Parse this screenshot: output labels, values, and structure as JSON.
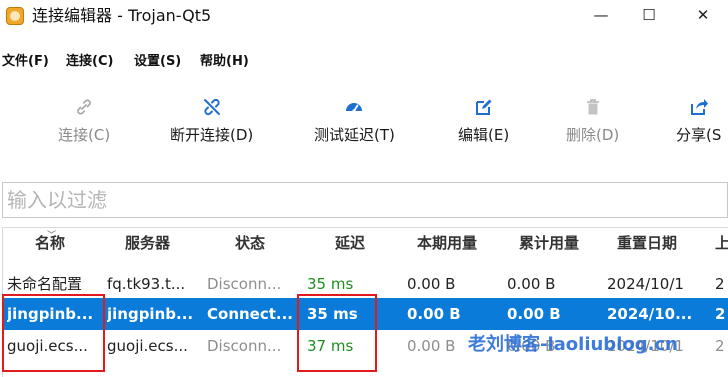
{
  "window": {
    "title": "连接编辑器 - Trojan-Qt5",
    "minimize": "—",
    "maximize": "☐",
    "close": "✕"
  },
  "menu": [
    "文件(F)",
    "连接(C)",
    "设置(S)",
    "帮助(H)"
  ],
  "toolbar": [
    {
      "label": "连接(C)",
      "icon": "link-icon",
      "enabled": false
    },
    {
      "label": "断开连接(D)",
      "icon": "unlink-icon",
      "enabled": true
    },
    {
      "label": "测试延迟(T)",
      "icon": "speedometer-icon",
      "enabled": true
    },
    {
      "label": "编辑(E)",
      "icon": "edit-icon",
      "enabled": true
    },
    {
      "label": "删除(D)",
      "icon": "trash-icon",
      "enabled": false
    },
    {
      "label": "分享(S",
      "icon": "share-icon",
      "enabled": true
    }
  ],
  "filter": {
    "placeholder": "输入以过滤",
    "value": ""
  },
  "columns": [
    "名称",
    "服务器",
    "状态",
    "延迟",
    "本期用量",
    "累计用量",
    "重置日期",
    "上"
  ],
  "rows": [
    {
      "name": "未命名配置",
      "server": "fq.tk93.t...",
      "status": "Disconn...",
      "latency": "35 ms",
      "period": "0.00  B",
      "total": "0.00  B",
      "reset": "2024/10/1",
      "extra": "2",
      "selected": false
    },
    {
      "name": "jingpinb...",
      "server": "jingpinb...",
      "status": "Connect...",
      "latency": "35 ms",
      "period": "0.00  B",
      "total": "0.00  B",
      "reset": "2024/10...",
      "extra": "2",
      "selected": true
    },
    {
      "name": "guoji.ecs...",
      "server": "guoji.ecs...",
      "status": "Disconn...",
      "latency": "37 ms",
      "period": "0.00  B",
      "total": "0.00  B",
      "reset": "2024/10/1",
      "extra": "2",
      "selected": false
    }
  ],
  "watermark": "老刘博客-laoliublog.cn",
  "colors": {
    "selection": "#0a7bd8",
    "latency_green": "#1e8f1e",
    "annotation_red": "#e01b1b"
  }
}
